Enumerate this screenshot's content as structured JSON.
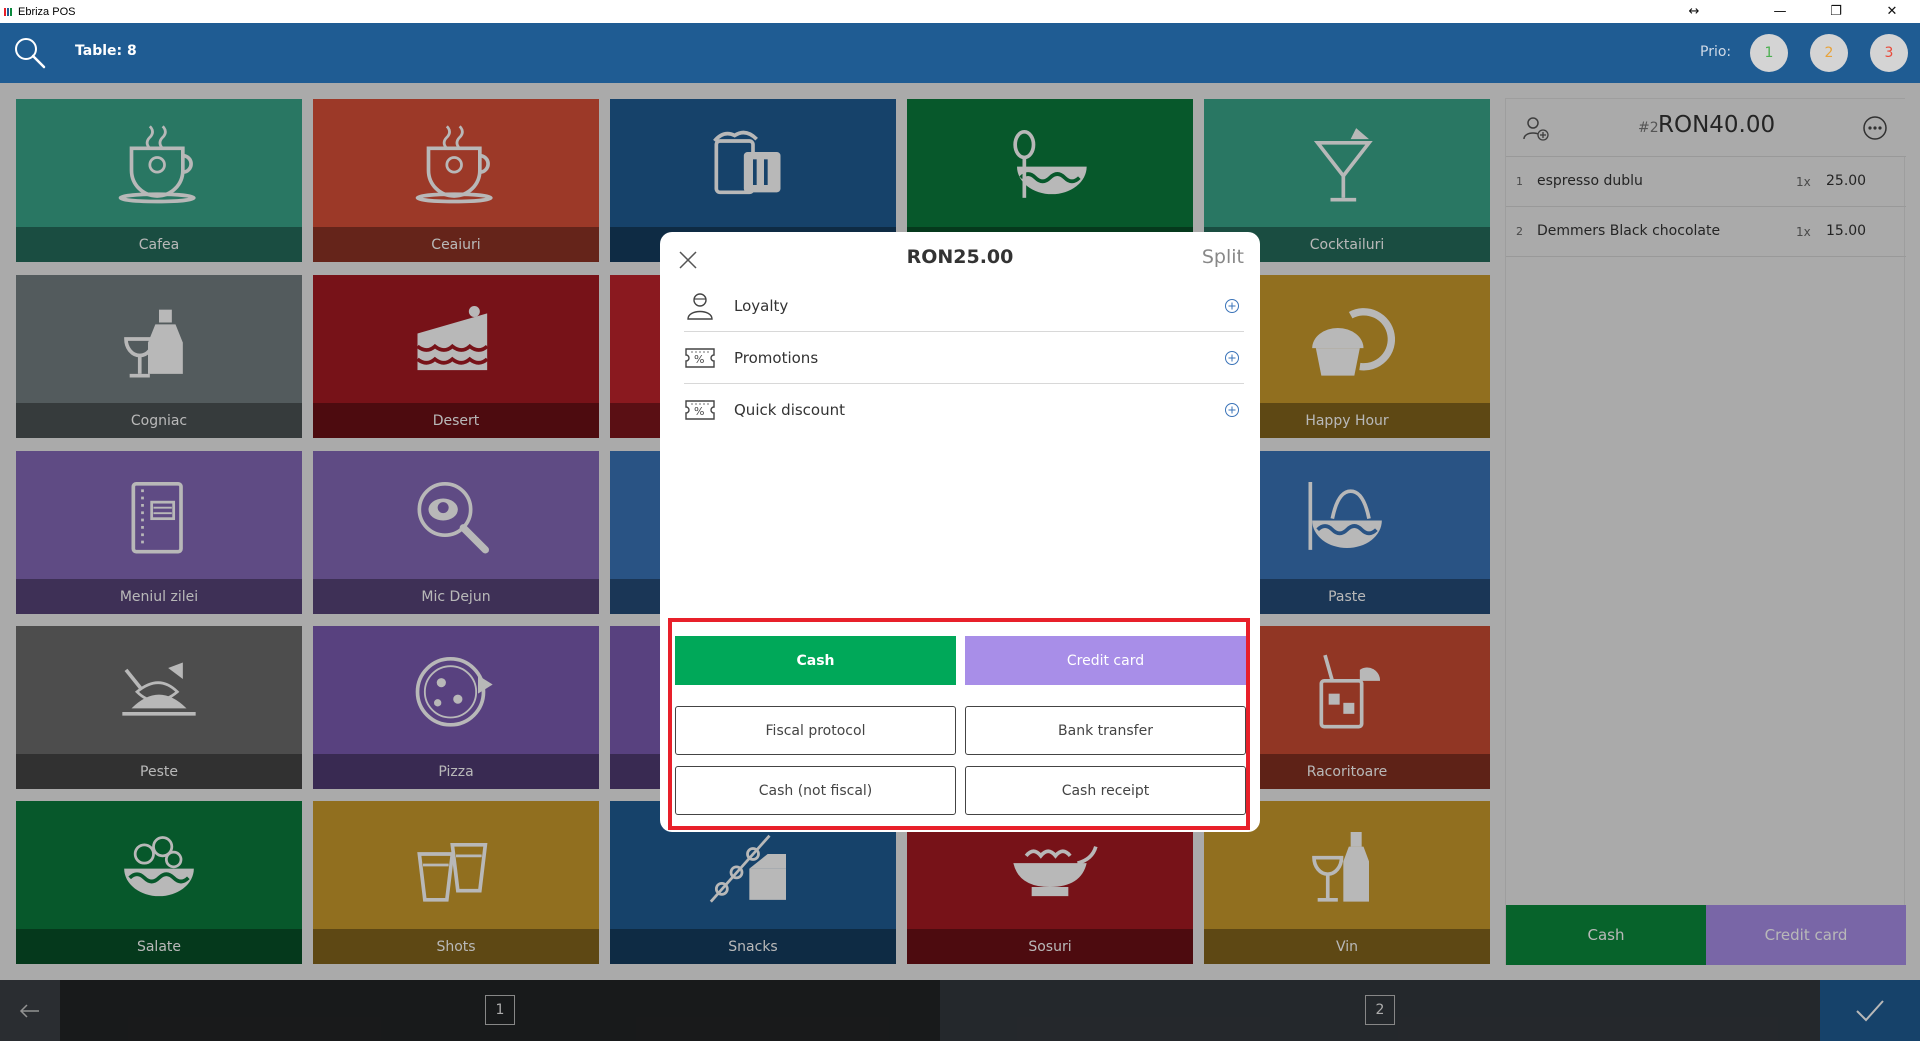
{
  "window": {
    "title": "Ebriza POS",
    "controls": [
      "↔",
      "—",
      "❐",
      "✕"
    ]
  },
  "header": {
    "table_label": "Table: 8",
    "prio_label": "Prio:",
    "prio_buttons": [
      {
        "label": "1",
        "color": "#4caf50"
      },
      {
        "label": "2",
        "color": "#e8a33a"
      },
      {
        "label": "3",
        "color": "#e84a3a"
      }
    ]
  },
  "categories": [
    {
      "label": "Cafea",
      "color": "#3aa58a",
      "icon": "coffee-cup-icon"
    },
    {
      "label": "Ceaiuri",
      "color": "#d94f38",
      "icon": "tea-cup-icon"
    },
    {
      "label": "",
      "color": "#1f5c93",
      "icon": "beer-mug-icon"
    },
    {
      "label": "",
      "color": "#0b7a3c",
      "icon": "soup-bowl-icon"
    },
    {
      "label": "Cocktailuri",
      "color": "#3aa58a",
      "icon": "cocktail-icon"
    },
    {
      "label": "Cogniac",
      "color": "#747f82",
      "icon": "cognac-bottle-icon"
    },
    {
      "label": "Desert",
      "color": "#a51a22",
      "icon": "cake-slice-icon"
    },
    {
      "label": "",
      "color": "#c0232b",
      "icon": ""
    },
    {
      "label": "",
      "color": "#1f5c93",
      "icon": ""
    },
    {
      "label": "Happy Hour",
      "color": "#c99a2c",
      "icon": "cupcake-icon"
    },
    {
      "label": "Meniul zilei",
      "color": "#8468b8",
      "icon": "menu-book-icon"
    },
    {
      "label": "Mic Dejun",
      "color": "#8468b8",
      "icon": "frying-pan-icon"
    },
    {
      "label": "",
      "color": "#3a73b8",
      "icon": ""
    },
    {
      "label": "",
      "color": "#3a73b8",
      "icon": ""
    },
    {
      "label": "Paste",
      "color": "#3a73b8",
      "icon": "pasta-icon"
    },
    {
      "label": "Peste",
      "color": "#6b6b6b",
      "icon": "fish-dish-icon"
    },
    {
      "label": "Pizza",
      "color": "#7b5bb0",
      "icon": "pizza-icon"
    },
    {
      "label": "",
      "color": "#7b5bb0",
      "icon": ""
    },
    {
      "label": "",
      "color": "#c94b32",
      "icon": ""
    },
    {
      "label": "Racoritoare",
      "color": "#c94b32",
      "icon": "soft-drink-icon"
    },
    {
      "label": "Salate",
      "color": "#0b7a3c",
      "icon": "salad-bowl-icon"
    },
    {
      "label": "Shots",
      "color": "#c99a2c",
      "icon": "shot-glasses-icon"
    },
    {
      "label": "Snacks",
      "color": "#1f5c93",
      "icon": "cheese-skewer-icon"
    },
    {
      "label": "Sosuri",
      "color": "#a51a22",
      "icon": "sauce-boat-icon"
    },
    {
      "label": "Vin",
      "color": "#c99a2c",
      "icon": "wine-icon"
    }
  ],
  "order": {
    "hash": "#2",
    "total": "RON40.00",
    "items": [
      {
        "num": "1",
        "name": "espresso dublu",
        "qty": "1x",
        "price": "25.00"
      },
      {
        "num": "2",
        "name": "Demmers Black chocolate",
        "qty": "1x",
        "price": "15.00"
      }
    ],
    "cash_label": "Cash",
    "card_label": "Credit card"
  },
  "pagination": {
    "page1": "1",
    "page2": "2"
  },
  "modal": {
    "amount": "RON25.00",
    "split_label": "Split",
    "rows": [
      {
        "label": "Loyalty",
        "icon": "person-icon"
      },
      {
        "label": "Promotions",
        "icon": "coupon-icon"
      },
      {
        "label": "Quick discount",
        "icon": "coupon-icon"
      }
    ],
    "payment_methods": {
      "cash": "Cash",
      "credit_card": "Credit card",
      "fiscal_protocol": "Fiscal protocol",
      "bank_transfer": "Bank transfer",
      "cash_not_fiscal": "Cash (not fiscal)",
      "cash_receipt": "Cash receipt"
    }
  },
  "colors": {
    "brand_blue": "#1f5c93",
    "cash_green": "#00a859",
    "card_purple": "#a88ee8",
    "order_cash_green": "#0b8a3c",
    "order_card_purple": "#a88ee8",
    "highlight_red": "#e8202a"
  }
}
